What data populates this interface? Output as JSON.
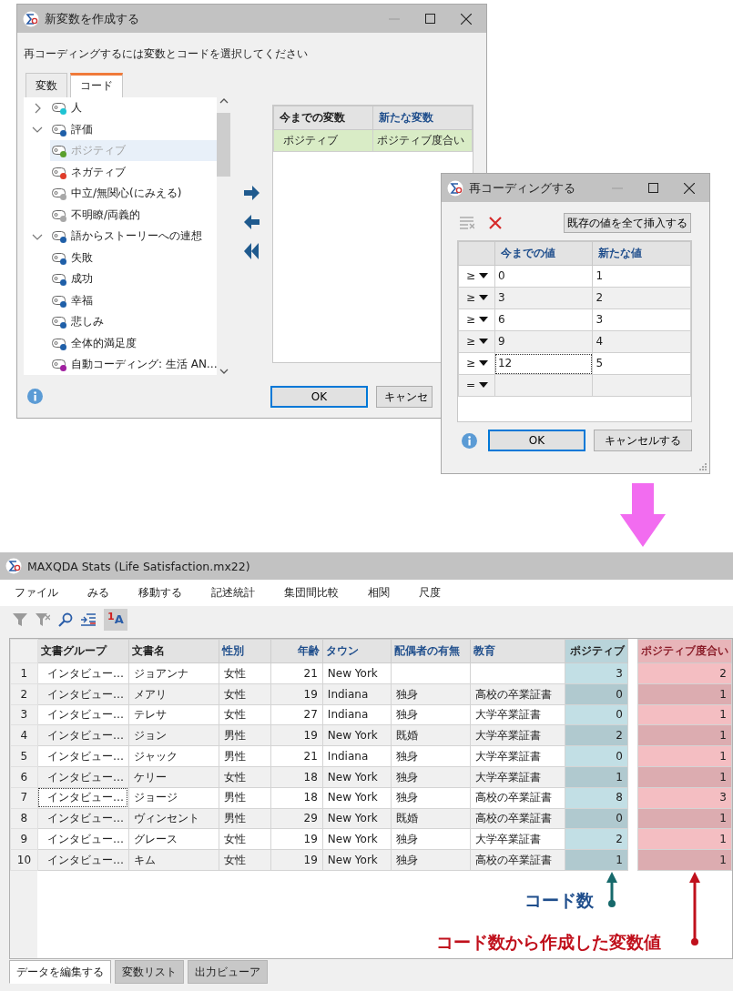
{
  "dialog_new_variable": {
    "title": "新変数を作成する",
    "instruction": "再コーディングするには変数とコードを選択してください",
    "tabs": [
      {
        "label": "変数",
        "selected": false
      },
      {
        "label": "コード",
        "selected": true
      }
    ],
    "code_tree": [
      {
        "label": "人",
        "kind": "group",
        "expanded": false,
        "selected": false,
        "color": "#1ec3d3"
      },
      {
        "label": "評価",
        "kind": "group",
        "expanded": true,
        "selected": false,
        "color": "#1f5fa8",
        "children": [
          {
            "label": "ポジティブ",
            "kind": "code",
            "selected": true,
            "color": "#5aa02c"
          },
          {
            "label": "ネガティブ",
            "kind": "code",
            "selected": false,
            "color": "#e03c2a"
          },
          {
            "label": "中立/無関心(にみえる)",
            "kind": "code",
            "selected": false,
            "color": "#a8a8a8"
          },
          {
            "label": "不明瞭/両義的",
            "kind": "code",
            "selected": false,
            "color": "#a8a8a8"
          }
        ]
      },
      {
        "label": "語からストーリーへの連想",
        "kind": "group",
        "expanded": true,
        "selected": false,
        "color": "#1f5fa8",
        "children": [
          {
            "label": "失敗",
            "kind": "code",
            "selected": false,
            "color": "#1f5fa8"
          },
          {
            "label": "成功",
            "kind": "code",
            "selected": false,
            "color": "#1f5fa8"
          },
          {
            "label": "幸福",
            "kind": "code",
            "selected": false,
            "color": "#1f5fa8"
          },
          {
            "label": "悲しみ",
            "kind": "code",
            "selected": false,
            "color": "#1f5fa8"
          }
        ]
      },
      {
        "label": "全体的満足度",
        "kind": "code",
        "selected": false,
        "color": "#1f5fa8"
      },
      {
        "label": "自動コーディング: 生活 AN…",
        "kind": "code",
        "selected": false,
        "color": "#a020a0"
      }
    ],
    "mapping_table": {
      "columns": [
        {
          "label": "今までの変数",
          "kind": "doc"
        },
        {
          "label": "新たな変数",
          "kind": "text"
        }
      ],
      "rows": [
        {
          "cells": [
            "ポジティブ",
            "ポジティブ度合い"
          ],
          "selected": true
        }
      ]
    },
    "buttons": [
      {
        "label": "OK",
        "default": true
      },
      {
        "label": "キャンセ",
        "default": false
      }
    ]
  },
  "dialog_recode": {
    "title": "再コーディングする",
    "insert_button": "既存の値を全て挿入する",
    "columns": [
      "今までの値",
      "新たな値"
    ],
    "rows": [
      {
        "operator": "≥",
        "old": "0",
        "new": "1",
        "focused": false
      },
      {
        "operator": "≥",
        "old": "3",
        "new": "2",
        "focused": false
      },
      {
        "operator": "≥",
        "old": "6",
        "new": "3",
        "focused": false
      },
      {
        "operator": "≥",
        "old": "9",
        "new": "4",
        "focused": false
      },
      {
        "operator": "≥",
        "old": "12",
        "new": "5",
        "focused": true
      },
      {
        "operator": "=",
        "focused": false
      }
    ],
    "buttons": [
      {
        "label": "OK",
        "default": true
      },
      {
        "label": "キャンセルする",
        "default": false
      }
    ]
  },
  "stats_window": {
    "title": "MAXQDA Stats (Life Satisfaction.mx22)",
    "menu": [
      "ファイル",
      "みる",
      "移動する",
      "記述統計",
      "集団間比較",
      "相関",
      "尺度"
    ],
    "toolbar": [
      {
        "kind": "filter",
        "selected": false
      },
      {
        "kind": "filter-clear",
        "selected": false
      },
      {
        "kind": "search",
        "selected": false
      },
      {
        "kind": "insert",
        "selected": false
      },
      {
        "kind": "sort",
        "label": "$^{1}$A",
        "selected": true
      }
    ],
    "table": {
      "columns": [
        {
          "label": "文書グループ",
          "kind": "doc"
        },
        {
          "label": "文書名",
          "kind": "doc"
        },
        {
          "label": "性別",
          "kind": "text"
        },
        {
          "label": "年齢",
          "kind": "number"
        },
        {
          "label": "タウン",
          "kind": "text"
        },
        {
          "label": "配偶者の有無",
          "kind": "text"
        },
        {
          "label": "教育",
          "kind": "text"
        },
        {
          "label": "ポジティブ",
          "kind": "code",
          "color": "#b9d4da"
        },
        {
          "label": "ポジティブ度合い",
          "kind": "code",
          "color": "#e8b5b9"
        }
      ],
      "rows": [
        {
          "number": "1",
          "focused": false,
          "cells": [
            "インタビュー…",
            "ジョアンナ",
            "女性",
            "21",
            "New York",
            null,
            null,
            "3",
            "2"
          ]
        },
        {
          "number": "2",
          "focused": false,
          "cells": [
            "インタビュー…",
            "メアリ",
            "女性",
            "19",
            "Indiana",
            "独身",
            "高校の卒業証書",
            "0",
            "1"
          ]
        },
        {
          "number": "3",
          "focused": false,
          "cells": [
            "インタビュー…",
            "テレサ",
            "女性",
            "27",
            "Indiana",
            "独身",
            "大学卒業証書",
            "0",
            "1"
          ]
        },
        {
          "number": "4",
          "focused": false,
          "cells": [
            "インタビュー…",
            "ジョン",
            "男性",
            "19",
            "New York",
            "既婚",
            "大学卒業証書",
            "2",
            "1"
          ]
        },
        {
          "number": "5",
          "focused": false,
          "cells": [
            "インタビュー…",
            "ジャック",
            "男性",
            "21",
            "Indiana",
            "独身",
            "大学卒業証書",
            "0",
            "1"
          ]
        },
        {
          "number": "6",
          "focused": false,
          "cells": [
            "インタビュー…",
            "ケリー",
            "女性",
            "18",
            "New York",
            "独身",
            "大学卒業証書",
            "1",
            "1"
          ]
        },
        {
          "number": "7",
          "focused": true,
          "cells": [
            "インタビュー…",
            "ジョージ",
            "男性",
            "18",
            "New York",
            "独身",
            "高校の卒業証書",
            "8",
            "3"
          ]
        },
        {
          "number": "8",
          "focused": false,
          "cells": [
            "インタビュー…",
            "ヴィンセント",
            "男性",
            "29",
            "New York",
            "既婚",
            "高校の卒業証書",
            "0",
            "1"
          ]
        },
        {
          "number": "9",
          "focused": false,
          "cells": [
            "インタビュー…",
            "グレース",
            "女性",
            "19",
            "New York",
            "独身",
            "大学卒業証書",
            "2",
            "1"
          ]
        },
        {
          "number": "10",
          "focused": false,
          "cells": [
            "インタビュー…",
            "キム",
            "女性",
            "19",
            "New York",
            "独身",
            "高校の卒業証書",
            "1",
            "1"
          ]
        }
      ]
    },
    "annotations": [
      {
        "text": "コード数",
        "kind": "count",
        "color": "#17696b"
      },
      {
        "text": "コード数から作成した変数値",
        "kind": "value",
        "color": "#c0101c"
      }
    ],
    "bottom_tabs": [
      {
        "label": "データを編集する",
        "selected": true
      },
      {
        "label": "変数リスト",
        "selected": false
      },
      {
        "label": "出力ビューア",
        "selected": false
      }
    ]
  }
}
